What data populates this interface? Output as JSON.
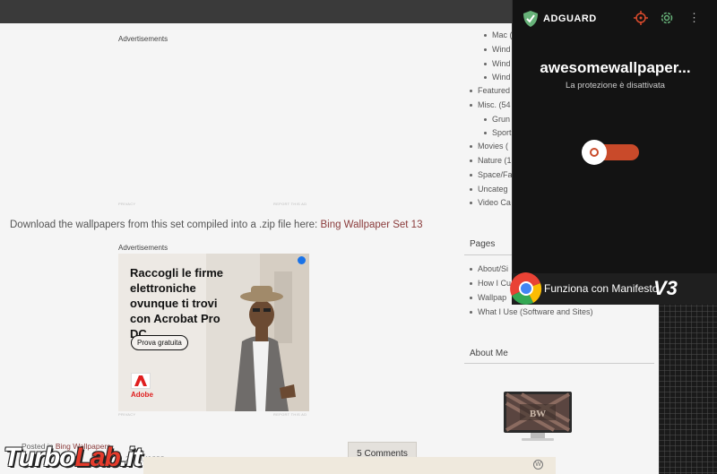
{
  "ads": {
    "label_top": "Advertisements",
    "label_mid": "Advertisements",
    "tiny_left": "PRIVACY",
    "tiny_right": "REPORT THIS AD"
  },
  "download": {
    "text": "Download the wallpapers from this set compiled into a .zip file here:",
    "link": "Bing Wallpaper Set 13"
  },
  "adobe_ad": {
    "headline": "Raccogli le firme elettroniche ovunque ti trovi con Acrobat Pro DC.",
    "cta": "Prova gratuita",
    "brand": "Adobe"
  },
  "sidebar": {
    "categories": [
      {
        "label": "Mac (",
        "indent": 1
      },
      {
        "label": "Wind",
        "indent": 1
      },
      {
        "label": "Wind",
        "indent": 1
      },
      {
        "label": "Wind",
        "indent": 1
      },
      {
        "label": "Featured",
        "indent": 0
      },
      {
        "label": "Misc. (54",
        "indent": 0
      },
      {
        "label": "Grun",
        "indent": 1
      },
      {
        "label": "Sport",
        "indent": 1
      },
      {
        "label": "Movies (",
        "indent": 0
      },
      {
        "label": "Nature (1",
        "indent": 0
      },
      {
        "label": "Space/Fa",
        "indent": 0
      },
      {
        "label": "Uncateg",
        "indent": 0
      },
      {
        "label": "Video Ca",
        "indent": 0
      }
    ],
    "pages_heading": "Pages",
    "pages": [
      "About/Si",
      "How I Cu",
      "Wallpap",
      "What I Use (Software and Sites)"
    ],
    "about_heading": "About Me",
    "about_img_label": "BW"
  },
  "post": {
    "posted_in": "Posted in",
    "category": "Bing Wallpapers",
    "tags_fragment": "2560X1600",
    "comments": "5 Comments"
  },
  "watermark": {
    "part1": "Turbo",
    "part2": "Lab",
    "part3": ".it"
  },
  "adguard": {
    "brand": "ADGUARD",
    "site": "awesomewallpaper...",
    "status": "La protezione è disattivata",
    "manifest_text": "Funziona con Manifesto",
    "manifest_version": "V3",
    "protection_enabled": false
  }
}
